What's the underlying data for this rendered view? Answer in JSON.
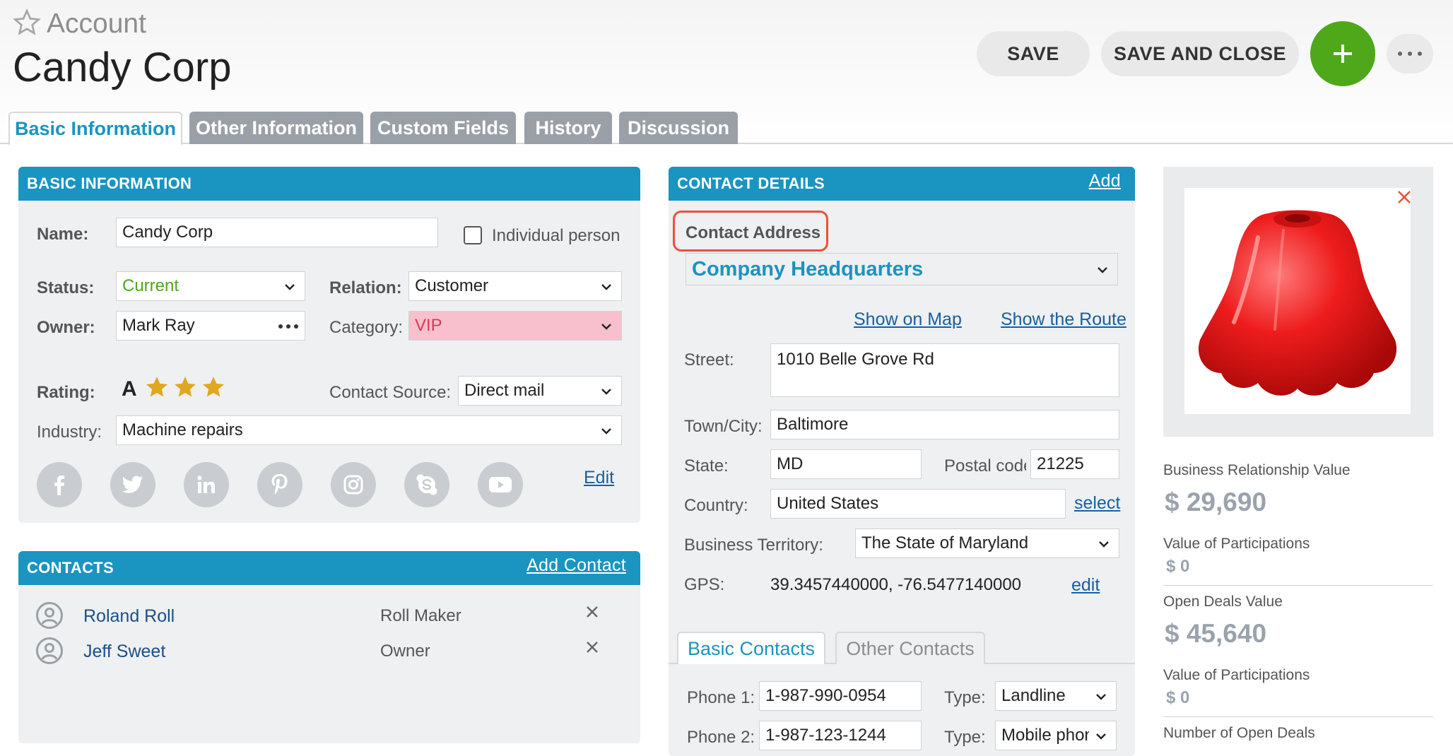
{
  "header": {
    "eyebrow": "Account",
    "title": "Candy Corp",
    "save_label": "SAVE",
    "save_close_label": "SAVE AND CLOSE"
  },
  "tabs": [
    {
      "label": "Basic Information",
      "active": true
    },
    {
      "label": "Other Information",
      "active": false
    },
    {
      "label": "Custom Fields",
      "active": false
    },
    {
      "label": "History",
      "active": false
    },
    {
      "label": "Discussion",
      "active": false
    }
  ],
  "basic_info": {
    "heading": "BASIC INFORMATION",
    "name_label": "Name:",
    "name_value": "Candy Corp",
    "individual_label": "Individual person",
    "status_label": "Status:",
    "status_value": "Current",
    "relation_label": "Relation:",
    "relation_value": "Customer",
    "owner_label": "Owner:",
    "owner_value": "Mark Ray",
    "category_label": "Category:",
    "category_value": "VIP",
    "rating_label": "Rating:",
    "rating_value": "A",
    "rating_stars": 3,
    "contact_source_label": "Contact Source:",
    "contact_source_value": "Direct mail",
    "industry_label": "Industry:",
    "industry_value": "Machine repairs",
    "edit_label": "Edit",
    "social_icons": [
      "facebook-icon",
      "twitter-icon",
      "linkedin-icon",
      "pinterest-icon",
      "instagram-icon",
      "skype-icon",
      "youtube-icon"
    ]
  },
  "contacts": {
    "heading": "CONTACTS",
    "add_label": "Add Contact",
    "items": [
      {
        "name": "Roland Roll",
        "role": "Roll Maker"
      },
      {
        "name": "Jeff Sweet",
        "role": "Owner"
      }
    ]
  },
  "contact_details": {
    "heading": "CONTACT DETAILS",
    "add_label": "Add",
    "address_label": "Contact Address",
    "address_value": "Company Headquarters",
    "show_map": "Show on Map",
    "show_route": "Show the Route",
    "street_label": "Street:",
    "street_value": "1010 Belle Grove Rd",
    "town_label": "Town/City:",
    "town_value": "Baltimore",
    "state_label": "State:",
    "state_value": "MD",
    "postal_label": "Postal code",
    "postal_value": "21225",
    "country_label": "Country:",
    "country_value": "United States",
    "select_label": "select",
    "territory_label": "Business Territory:",
    "territory_value": "The State of Maryland",
    "gps_label": "GPS:",
    "gps_value": "39.3457440000, -76.5477140000",
    "gps_edit": "edit",
    "subtabs": [
      {
        "label": "Basic Contacts",
        "active": true
      },
      {
        "label": "Other Contacts",
        "active": false
      }
    ],
    "phone1_label": "Phone 1:",
    "phone1_value": "1-987-990-0954",
    "type1_label": "Type:",
    "type1_value": "Landline",
    "phone2_label": "Phone 2:",
    "phone2_value": "1-987-123-1244",
    "type2_label": "Type:",
    "type2_value": "Mobile phone"
  },
  "stats": {
    "brv_label": "Business Relationship Value",
    "brv_value": "$ 29,690",
    "vop1_label": "Value of Participations",
    "vop1_value": "$ 0",
    "odv_label": "Open Deals Value",
    "odv_value": "$ 45,640",
    "vop2_label": "Value of Participations",
    "vop2_value": "$ 0",
    "nod_label": "Number of Open Deals"
  },
  "colors": {
    "accent": "#1a94c0",
    "add_button": "#4ea81a",
    "status_green": "#4ea81a",
    "vip_pink": "#f7c0cc",
    "highlight_red": "#e8523a",
    "star_gold": "#e0a820"
  }
}
